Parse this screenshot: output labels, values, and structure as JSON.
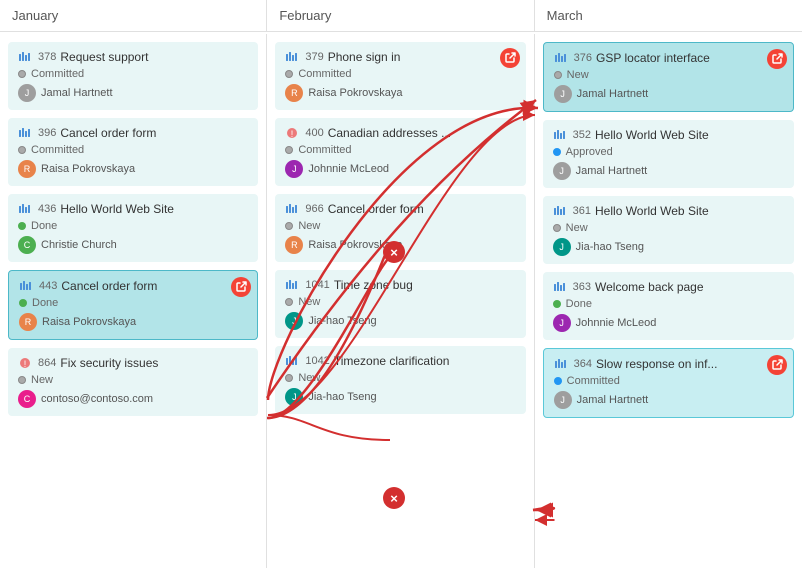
{
  "header": {
    "columns": [
      "January",
      "February",
      "March"
    ]
  },
  "columns": [
    {
      "name": "January",
      "cards": [
        {
          "id": "378",
          "title": "Request support",
          "status": "Committed",
          "statusType": "committed",
          "assignee": "Jamal Hartnett",
          "avatarColor": "gray",
          "avatarInitial": "J",
          "hasLink": false,
          "highlighted": false,
          "isBug": false
        },
        {
          "id": "396",
          "title": "Cancel order form",
          "status": "Committed",
          "statusType": "committed",
          "assignee": "Raisa Pokrovskaya",
          "avatarColor": "orange",
          "avatarInitial": "R",
          "hasLink": false,
          "highlighted": false,
          "isBug": false
        },
        {
          "id": "436",
          "title": "Hello World Web Site",
          "status": "Done",
          "statusType": "done",
          "assignee": "Christie Church",
          "avatarColor": "green",
          "avatarInitial": "C",
          "hasLink": false,
          "highlighted": false,
          "isBug": false
        },
        {
          "id": "443",
          "title": "Cancel order form",
          "status": "Done",
          "statusType": "done",
          "assignee": "Raisa Pokrovskaya",
          "avatarColor": "orange",
          "avatarInitial": "R",
          "hasLink": true,
          "highlighted": true,
          "isBug": false
        },
        {
          "id": "864",
          "title": "Fix security issues",
          "status": "New",
          "statusType": "new",
          "assignee": "contoso@contoso.com",
          "avatarColor": "pink",
          "avatarInitial": "c",
          "hasLink": false,
          "highlighted": false,
          "isBug": true
        }
      ]
    },
    {
      "name": "February",
      "cards": [
        {
          "id": "379",
          "title": "Phone sign in",
          "status": "Committed",
          "statusType": "committed",
          "assignee": "Raisa Pokrovskaya",
          "avatarColor": "orange",
          "avatarInitial": "R",
          "hasLink": true,
          "highlighted": false,
          "isBug": false
        },
        {
          "id": "400",
          "title": "Canadian addresses ...",
          "status": "Committed",
          "statusType": "committed",
          "assignee": "Johnnie McLeod",
          "avatarColor": "purple",
          "avatarInitial": "J",
          "hasLink": false,
          "highlighted": false,
          "isBug": true
        },
        {
          "id": "966",
          "title": "Cancel order form",
          "status": "New",
          "statusType": "new",
          "assignee": "Raisa Pokrovskaya",
          "avatarColor": "orange",
          "avatarInitial": "R",
          "hasLink": false,
          "highlighted": false,
          "isBug": false
        },
        {
          "id": "1041",
          "title": "Time zone bug",
          "status": "New",
          "statusType": "new",
          "assignee": "Jia-hao Tseng",
          "avatarColor": "teal",
          "avatarInitial": "J",
          "hasLink": false,
          "highlighted": false,
          "isBug": false
        },
        {
          "id": "1042",
          "title": "Timezone clarification",
          "status": "New",
          "statusType": "new",
          "assignee": "Jia-hao Tseng",
          "avatarColor": "teal",
          "avatarInitial": "J",
          "hasLink": false,
          "highlighted": false,
          "isBug": false
        }
      ]
    },
    {
      "name": "March",
      "cards": [
        {
          "id": "376",
          "title": "GSP locator interface",
          "status": "New",
          "statusType": "new",
          "assignee": "Jamal Hartnett",
          "avatarColor": "gray",
          "avatarInitial": "J",
          "hasLink": true,
          "highlighted": true,
          "isBug": false
        },
        {
          "id": "352",
          "title": "Hello World Web Site",
          "status": "Approved",
          "statusType": "approved",
          "assignee": "Jamal Hartnett",
          "avatarColor": "gray",
          "avatarInitial": "J",
          "hasLink": false,
          "highlighted": false,
          "isBug": false
        },
        {
          "id": "361",
          "title": "Hello World Web Site",
          "status": "New",
          "statusType": "new",
          "assignee": "Jia-hao Tseng",
          "avatarColor": "teal",
          "avatarInitial": "J",
          "hasLink": false,
          "highlighted": false,
          "isBug": false
        },
        {
          "id": "363",
          "title": "Welcome back page",
          "status": "Done",
          "statusType": "done",
          "assignee": "Johnnie McLeod",
          "avatarColor": "purple",
          "avatarInitial": "J",
          "hasLink": false,
          "highlighted": false,
          "isBug": false
        },
        {
          "id": "364",
          "title": "Slow response on inf...",
          "status": "Committed",
          "statusType": "committed-blue",
          "assignee": "Jamal Hartnett",
          "avatarColor": "gray",
          "avatarInitial": "J",
          "hasLink": true,
          "highlighted": true,
          "isBug": false
        }
      ]
    }
  ]
}
